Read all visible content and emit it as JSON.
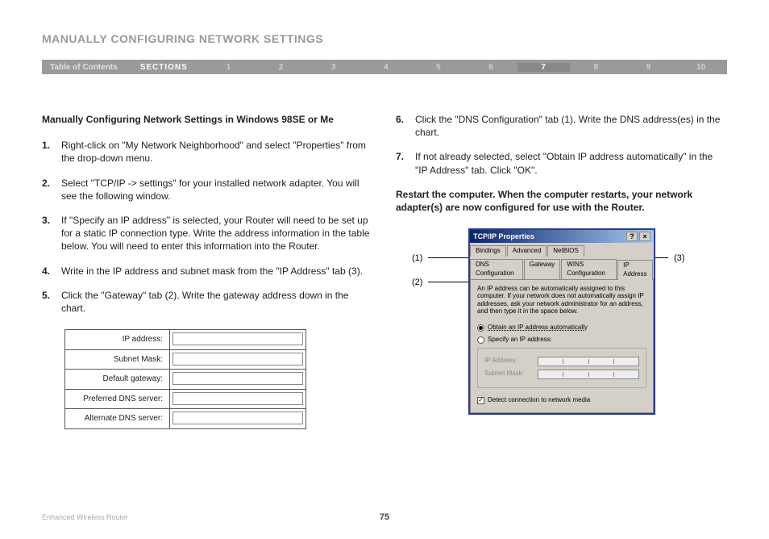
{
  "page_title": "MANUALLY CONFIGURING NETWORK SETTINGS",
  "nav": {
    "toc": "Table of Contents",
    "sections_label": "SECTIONS",
    "items": [
      "1",
      "2",
      "3",
      "4",
      "5",
      "6",
      "7",
      "8",
      "9",
      "10"
    ],
    "active": "7"
  },
  "subtitle": "Manually Configuring Network Settings in Windows 98SE or Me",
  "steps_left": [
    {
      "n": "1.",
      "t": "Right-click on \"My Network Neighborhood\" and select \"Properties\" from the drop-down menu."
    },
    {
      "n": "2.",
      "t": "Select \"TCP/IP -> settings\" for your installed network adapter. You will see the following window."
    },
    {
      "n": "3.",
      "t": "If \"Specify an IP address\" is selected, your Router will need to be set up for a static IP connection type. Write the address information in the table below. You will need to enter this information into the Router."
    },
    {
      "n": "4.",
      "t": "Write in the IP address and subnet mask from the \"IP Address\" tab (3)."
    },
    {
      "n": "5.",
      "t": "Click the \"Gateway\" tab (2). Write the gateway address down in the chart."
    }
  ],
  "steps_right": [
    {
      "n": "6.",
      "t": "Click the \"DNS Configuration\" tab (1). Write the DNS address(es) in the chart."
    },
    {
      "n": "7.",
      "t": "If not already selected, select \"Obtain IP address automatically\" in the \"IP Address\" tab. Click \"OK\"."
    }
  ],
  "restart_text": "Restart the computer. When the computer restarts, your network adapter(s) are now configured for use with the Router.",
  "chart_rows": [
    "IP address:",
    "Subnet Mask:",
    "Default gateway:",
    "Preferred DNS server:",
    "Alternate DNS server:"
  ],
  "callouts": {
    "c1": "(1)",
    "c2": "(2)",
    "c3": "(3)"
  },
  "dialog": {
    "title": "TCP/IP Properties",
    "tabs_row1": [
      "Bindings",
      "Advanced",
      "NetBIOS"
    ],
    "tabs_row2": [
      "DNS Configuration",
      "Gateway",
      "WINS Configuration",
      "IP Address"
    ],
    "desc": "An IP address can be automatically assigned to this computer. If your network does not automatically assign IP addresses, ask your network administrator for an address, and then type it in the space below.",
    "opt_auto": "Obtain an IP address automatically",
    "opt_spec": "Specify an IP address:",
    "ip_label": "IP Address:",
    "sm_label": "Subnet Mask:",
    "detect": "Detect connection to network media"
  },
  "footer": {
    "product": "Enhanced Wireless Router",
    "page": "75"
  }
}
